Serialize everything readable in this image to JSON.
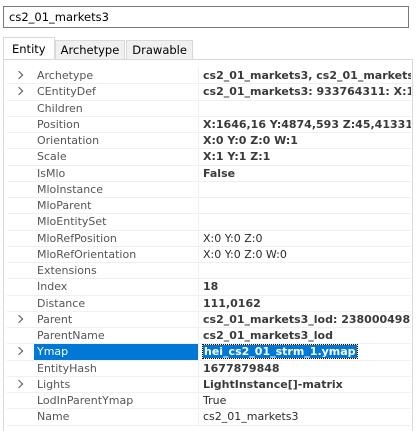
{
  "search": {
    "value": "cs2_01_markets3"
  },
  "tabs": [
    {
      "label": "Entity"
    },
    {
      "label": "Archetype"
    },
    {
      "label": "Drawable"
    }
  ],
  "properties": [
    {
      "name": "Archetype",
      "value": "cs2_01_markets3, cs2_01_markets3,",
      "expandable": true,
      "bold": true
    },
    {
      "name": "CEntityDef",
      "value": "cs2_01_markets3: 933764311: X:1646",
      "expandable": true,
      "bold": true
    },
    {
      "name": "Children",
      "value": "",
      "expandable": false,
      "bold": false
    },
    {
      "name": "Position",
      "value": "X:1646,16 Y:4874,593 Z:45,41331",
      "expandable": false,
      "bold": true
    },
    {
      "name": "Orientation",
      "value": "X:0 Y:0 Z:0 W:1",
      "expandable": false,
      "bold": true
    },
    {
      "name": "Scale",
      "value": "X:1 Y:1 Z:1",
      "expandable": false,
      "bold": true
    },
    {
      "name": "IsMlo",
      "value": "False",
      "expandable": false,
      "bold": true
    },
    {
      "name": "MloInstance",
      "value": "",
      "expandable": false,
      "bold": false
    },
    {
      "name": "MloParent",
      "value": "",
      "expandable": false,
      "bold": false
    },
    {
      "name": "MloEntitySet",
      "value": "",
      "expandable": false,
      "bold": false
    },
    {
      "name": "MloRefPosition",
      "value": "X:0 Y:0 Z:0",
      "expandable": false,
      "bold": false
    },
    {
      "name": "MloRefOrientation",
      "value": "X:0 Y:0 Z:0 W:0",
      "expandable": false,
      "bold": false
    },
    {
      "name": "Extensions",
      "value": "",
      "expandable": false,
      "bold": false
    },
    {
      "name": "Index",
      "value": "18",
      "expandable": false,
      "bold": true
    },
    {
      "name": "Distance",
      "value": "111,0162",
      "expandable": false,
      "bold": true
    },
    {
      "name": "Parent",
      "value": "cs2_01_markets3_lod: 2380004987: X",
      "expandable": true,
      "bold": true
    },
    {
      "name": "ParentName",
      "value": "cs2_01_markets3_lod",
      "expandable": false,
      "bold": true
    },
    {
      "name": "Ymap",
      "value": "hei_cs2_01_strm_1.ymap",
      "expandable": true,
      "bold": true,
      "selected": true
    },
    {
      "name": "EntityHash",
      "value": "1677879848",
      "expandable": false,
      "bold": true
    },
    {
      "name": "Lights",
      "value": "LightInstance[]-matrix",
      "expandable": true,
      "bold": true
    },
    {
      "name": "LodInParentYmap",
      "value": "True",
      "expandable": false,
      "bold": false
    },
    {
      "name": "Name",
      "value": "cs2_01_markets3",
      "expandable": false,
      "bold": false
    }
  ]
}
